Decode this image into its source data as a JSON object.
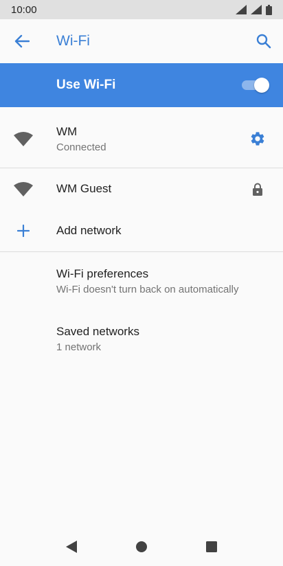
{
  "status_bar": {
    "time": "10:00",
    "icons": [
      "wifi-signal-icon",
      "cell-signal-icon",
      "battery-icon"
    ]
  },
  "app_bar": {
    "title": "Wi-Fi",
    "back_icon": "arrow-back-icon",
    "search_icon": "search-icon"
  },
  "master_switch": {
    "label": "Use Wi-Fi",
    "enabled": true
  },
  "networks": [
    {
      "name": "WM",
      "status": "Connected",
      "icon": "wifi-icon",
      "trailing_icon": "gear-icon"
    },
    {
      "name": "WM Guest",
      "status": "",
      "icon": "wifi-icon",
      "trailing_icon": "lock-icon"
    }
  ],
  "add_network": {
    "label": "Add network",
    "icon": "plus-icon"
  },
  "preferences": {
    "title": "Wi-Fi preferences",
    "subtitle": "Wi-Fi doesn't turn back on automatically"
  },
  "saved_networks": {
    "title": "Saved networks",
    "subtitle": "1 network"
  },
  "nav_bar": {
    "icons": [
      "back-triangle-icon",
      "home-circle-icon",
      "recents-square-icon"
    ]
  },
  "colors": {
    "accent": "#3a7fd5",
    "header_bar": "#3f85e0",
    "status_bar": "#e0e0e0",
    "background": "#fafafa"
  }
}
